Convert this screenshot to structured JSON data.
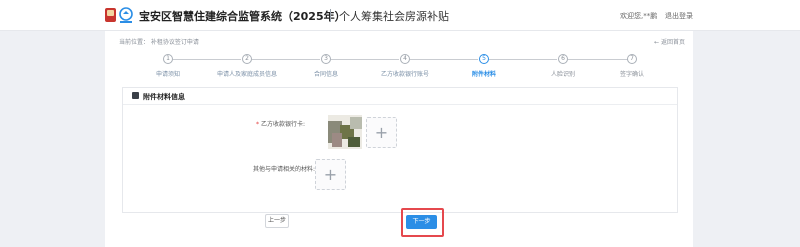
{
  "header": {
    "system_title": "宝安区智慧住建综合监管系统（2025年）",
    "module_title": "个人筹集社会房源补贴",
    "welcome": "欢迎您,**鹏",
    "logout": "退出登录"
  },
  "breadcrumb": "当前位置：  补租协议签订申请",
  "back_home": "← 返回首页",
  "steps": [
    {
      "num": "1",
      "label": "申请须知",
      "state": "done"
    },
    {
      "num": "2",
      "label": "申请人及家庭成员信息",
      "state": "done"
    },
    {
      "num": "3",
      "label": "合同信息",
      "state": "done"
    },
    {
      "num": "4",
      "label": "乙方收款银行账号",
      "state": "done"
    },
    {
      "num": "5",
      "label": "附件材料",
      "state": "active"
    },
    {
      "num": "6",
      "label": "人脸识别",
      "state": "future"
    },
    {
      "num": "7",
      "label": "签字确认",
      "state": "future"
    }
  ],
  "panel": {
    "title": "附件材料信息",
    "fields": [
      {
        "required": "*",
        "label": "乙方收款银行卡:"
      },
      {
        "required": "",
        "label": "其他与申请相关的材料:"
      }
    ],
    "plus": "+"
  },
  "buttons": {
    "prev": "上一步",
    "next": "下一步"
  },
  "colors": {
    "accent": "#2b8ee6",
    "highlight": "#e5484d"
  }
}
